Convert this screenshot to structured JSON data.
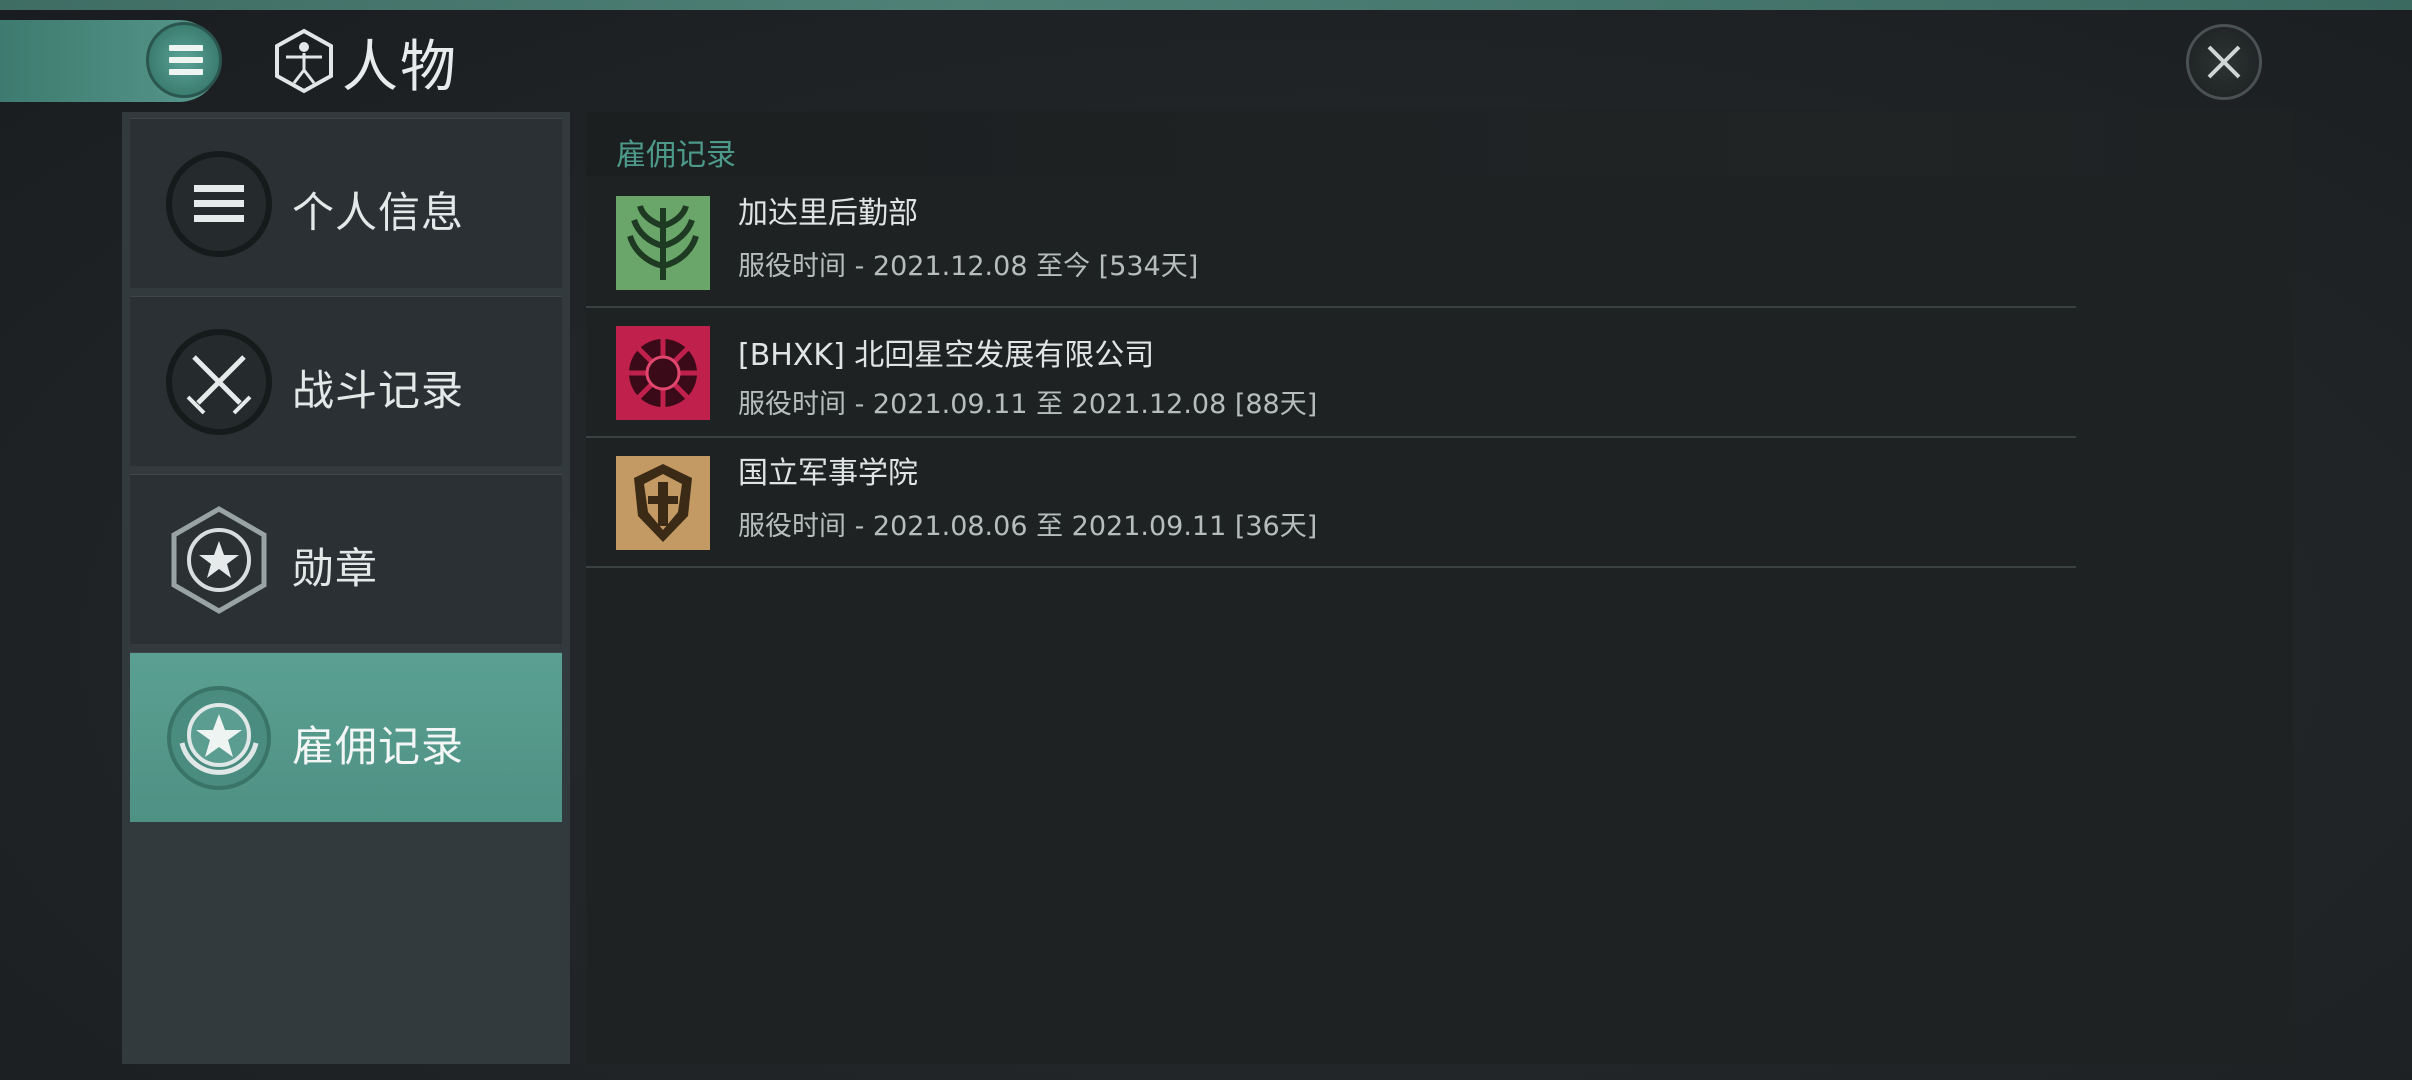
{
  "header": {
    "title": "人物",
    "menu_icon": "menu-list-icon",
    "title_icon": "human-figure-icon",
    "close_icon": "close-icon"
  },
  "sidebar": {
    "items": [
      {
        "label": "个人信息",
        "icon": "list-icon",
        "active": false
      },
      {
        "label": "战斗记录",
        "icon": "crossed-swords-icon",
        "active": false
      },
      {
        "label": "勋章",
        "icon": "star-hexagon-icon",
        "active": false
      },
      {
        "label": "雇佣记录",
        "icon": "star-laurel-icon",
        "active": true
      }
    ]
  },
  "main": {
    "section_title": "雇佣记录",
    "records": [
      {
        "name": "加达里后勤部",
        "time": "服役时间 - 2021.12.08 至今 [534天]",
        "logo": "green-wheat-emblem",
        "logo_color": "#6aa56a"
      },
      {
        "name": " [BHXK] 北回星空发展有限公司",
        "time": "服役时间 - 2021.09.11 至 2021.12.08 [88天]",
        "logo": "red-sunburst-emblem",
        "logo_color": "#c0214c"
      },
      {
        "name": "国立军事学院",
        "time": "服役时间 - 2021.08.06 至 2021.09.11 [36天]",
        "logo": "gold-shield-emblem",
        "logo_color": "#c49a64"
      }
    ]
  },
  "colors": {
    "accent": "#4f9184",
    "section_title": "#4d9a8b",
    "background": "#222628"
  }
}
